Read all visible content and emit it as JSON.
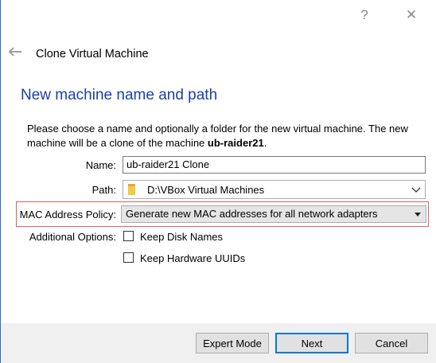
{
  "title_bar": {
    "help_glyph": "?",
    "close_glyph": "✕"
  },
  "header": {
    "title": "Clone Virtual Machine"
  },
  "section": {
    "title": "New machine name and path"
  },
  "description": {
    "prefix": "Please choose a name and optionally a folder for the new virtual machine. The new machine will be a clone of the machine ",
    "machine": "ub-raider21",
    "suffix": "."
  },
  "form": {
    "name_label": "Name:",
    "name_value": "ub-raider21 Clone",
    "path_label": "Path:",
    "path_value": "D:\\VBox Virtual Machines",
    "mac_label": "MAC Address Policy:",
    "mac_value": "Generate new MAC addresses for all network adapters",
    "additional_label": "Additional Options:",
    "keep_disk_names": "Keep Disk Names",
    "keep_hardware_uuids": "Keep Hardware UUIDs"
  },
  "buttons": {
    "expert": "Expert Mode",
    "next": "Next",
    "cancel": "Cancel"
  },
  "colors": {
    "heading": "#1a3fae",
    "highlight_border": "#e06060",
    "accent": "#0078d7"
  },
  "icons": [
    "help-icon",
    "close-icon",
    "back-arrow-icon",
    "folder-icon",
    "chevron-down-icon",
    "dropdown-arrow-icon"
  ]
}
